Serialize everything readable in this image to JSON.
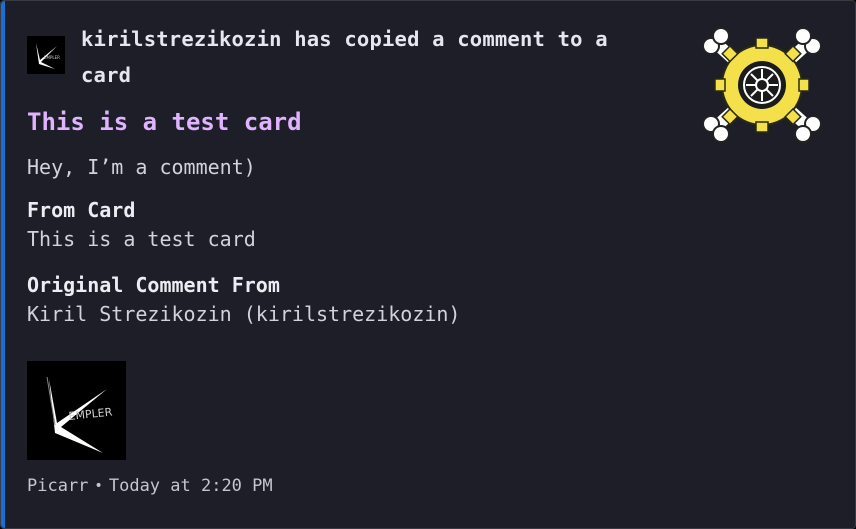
{
  "embed": {
    "accent_color": "#1a6fd6",
    "author": {
      "name": "kirilstrezikozin has copied a comment to a card",
      "avatar_icon": "kempler-logo-icon"
    },
    "thumbnail_icon": "gear-skull-crossbones-icon",
    "title": "This is a test card",
    "description": "Hey, I’m a comment)",
    "fields": [
      {
        "name": "From Card",
        "value": "This is a test card"
      },
      {
        "name": "Original Comment From",
        "value": "Kiril Strezikozin (kirilstrezikozin)"
      }
    ],
    "image_icon": "kempler-logo-icon",
    "logo_text": "EMPLER",
    "footer": {
      "text": "Picarr",
      "separator": "•",
      "timestamp": "Today at 2:20 PM"
    }
  }
}
